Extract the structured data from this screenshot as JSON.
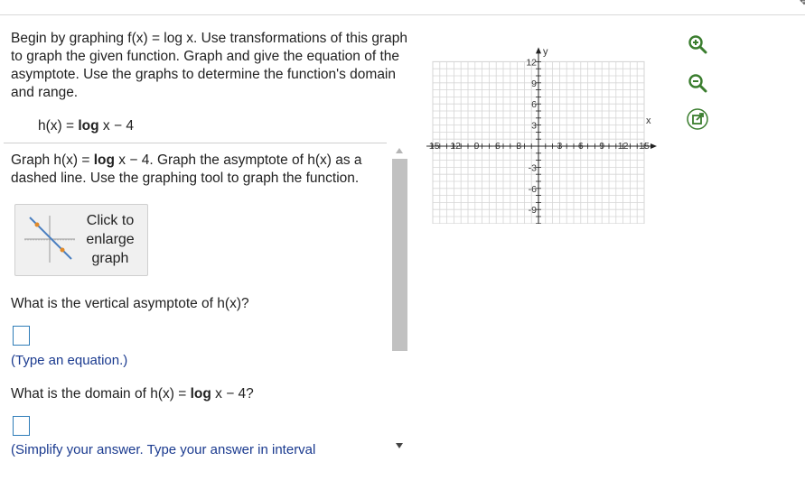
{
  "problem": {
    "text": "Begin by graphing f(x) = log x. Use transformations of this graph to graph the given function. Graph and give the equation of the asymptote. Use the graphs to determine the function's domain and range.",
    "func_prefix": "h(x) = ",
    "func_log": "log",
    "func_suffix": " x − 4"
  },
  "instruction": {
    "prefix": "Graph h(x) = ",
    "log": "log",
    "suffix": " x − 4. Graph the asymptote of h(x) as a dashed line. Use the graphing tool to graph the function."
  },
  "enlarge_button": {
    "line1": "Click to",
    "line2": "enlarge",
    "line3": "graph"
  },
  "question1": {
    "text": "What is the vertical asymptote of h(x)?",
    "hint": "(Type an equation.)"
  },
  "question2": {
    "prefix": "What is the domain of h(x) = ",
    "log": "log",
    "suffix": " x − 4?",
    "hint": "(Simplify your answer. Type your answer in interval"
  },
  "graph": {
    "x_label": "x",
    "y_label": "y",
    "x_ticks": [
      "-15",
      "-12",
      "-9",
      "-6",
      "-3",
      "3",
      "6",
      "9",
      "12",
      "15"
    ],
    "y_ticks": [
      "12",
      "9",
      "6",
      "3",
      "-3",
      "-6",
      "-9",
      "-12"
    ]
  },
  "tools": [
    "zoom-in-icon",
    "zoom-out-icon",
    "pop-out-icon"
  ],
  "colors": {
    "answer_box": "#2e7cb8",
    "hint_text": "#1a3a8f",
    "tool_green": "#3a7d2e"
  }
}
